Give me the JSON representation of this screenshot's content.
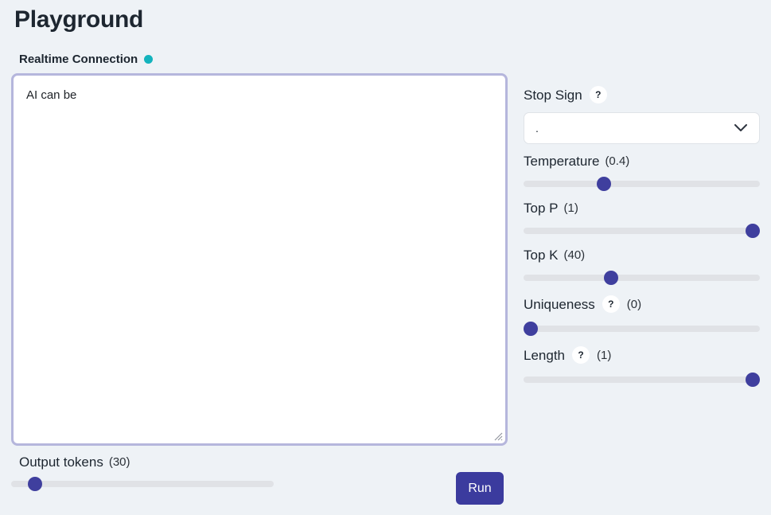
{
  "page": {
    "title": "Playground",
    "accent_color": "#3b3b9e",
    "background_color": "#eef2f6",
    "connection_dot_color": "#13b3bd",
    "focus_ring_color": "#b5b6dc"
  },
  "connection": {
    "label": "Realtime Connection",
    "status_icon": "status-dot",
    "status": "connected"
  },
  "prompt": {
    "value": "AI can be",
    "placeholder": ""
  },
  "output_tokens": {
    "name": "Output tokens",
    "value": "(30)",
    "percent": 9
  },
  "run": {
    "label": "Run"
  },
  "controls": {
    "stop_sign": {
      "name": "Stop Sign",
      "help": "?",
      "selected": ".",
      "chevron_icon": "chevron-down-icon"
    },
    "temperature": {
      "name": "Temperature",
      "value": "(0.4)",
      "percent": 34
    },
    "top_p": {
      "name": "Top P",
      "value": "(1)",
      "percent": 97
    },
    "top_k": {
      "name": "Top K",
      "value": "(40)",
      "percent": 37
    },
    "uniqueness": {
      "name": "Uniqueness",
      "help": "?",
      "value": "(0)",
      "percent": 3
    },
    "length": {
      "name": "Length",
      "help": "?",
      "value": "(1)",
      "percent": 97
    }
  }
}
